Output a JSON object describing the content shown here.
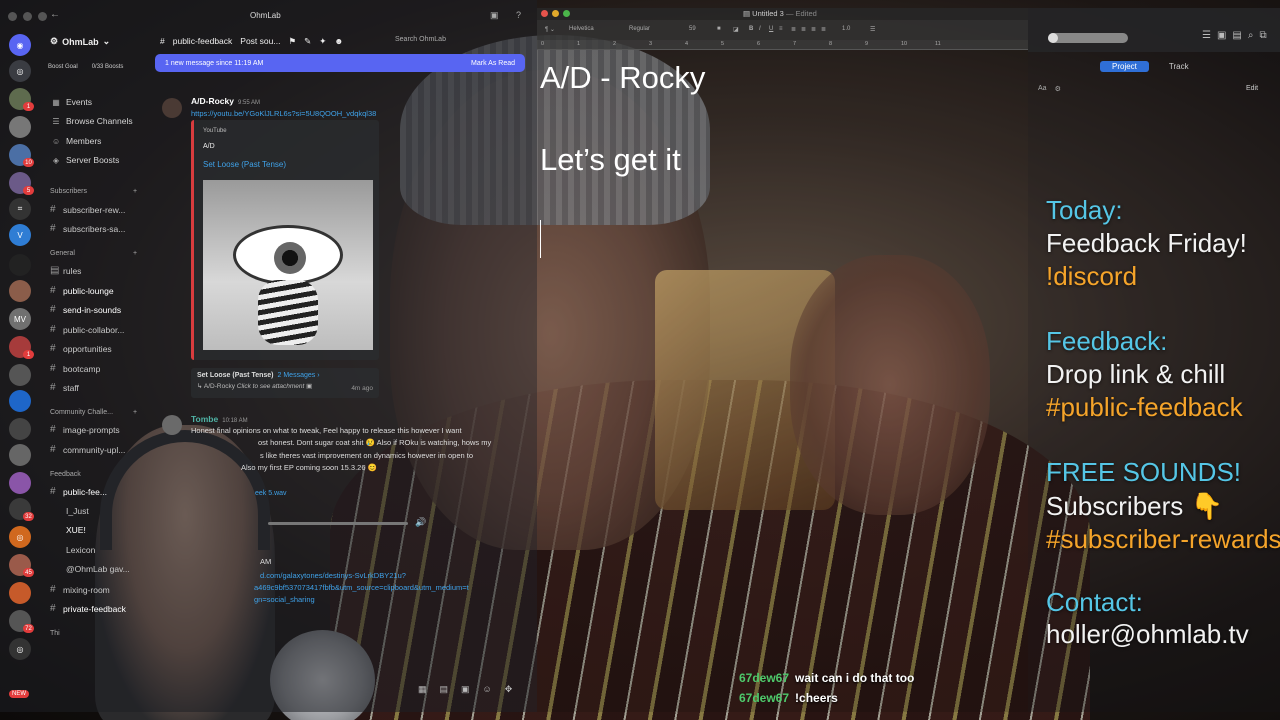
{
  "discord": {
    "window_title": "OhmLab",
    "server_name": "OhmLab",
    "boost_goal_label": "Boost Goal",
    "boost_count": "0/33 Boosts",
    "nav": [
      "Events",
      "Browse Channels",
      "Members",
      "Server Boosts"
    ],
    "categories": {
      "subscribers": "Subscribers",
      "general": "General",
      "community": "Community Challe...",
      "feedback": "Feedback",
      "truncated": "Thi"
    },
    "channels": {
      "subscriber_rewards": "subscriber-rew...",
      "subscribers_sa": "subscribers-sa...",
      "rules": "rules",
      "public_lounge": "public-lounge",
      "send_in_sounds": "send-in-sounds",
      "public_collabor": "public-collabor...",
      "opportunities": "opportunities",
      "bootcamp": "bootcamp",
      "staff": "staff",
      "image_prompts": "image-prompts",
      "community_upl": "community-upl...",
      "public_feedback": "public-fee...",
      "sub_i_just": "I_Just",
      "sub_xuei": "XUE!",
      "sub_lexicon": "Lexicon",
      "sub_ohmlab": "@OhmLab gav...",
      "mixing_room": "mixing-room",
      "private_feedback": "private-feedback"
    },
    "rail_badges": [
      "1",
      "10",
      "5",
      "1",
      "32",
      "45",
      "72"
    ],
    "rail_new": "NEW",
    "channel_header": "public-feedback",
    "header_post": "Post sou...",
    "search_placeholder": "Search OhmLab",
    "new_messages_banner": "1 new message since 11:19 AM",
    "mark_as_read": "Mark As Read",
    "msg1": {
      "author": "A/D-Rocky",
      "time": "9:55 AM",
      "link": "https://youtu.be/YGoKlJLRL6s?si=5U8QOOH_vdqkql38",
      "embed_provider": "YouTube",
      "embed_author": "A/D",
      "embed_title": "Set Loose (Past Tense)"
    },
    "thread": {
      "title": "Set Loose (Past Tense)",
      "count": "2 Messages ›",
      "author": "A/D-Rocky",
      "preview": "Click to see attachment",
      "ago": "4m ago"
    },
    "msg2": {
      "author": "Tombe",
      "time": "10:18 AM",
      "line1": "Honest final opinions on what to tweak, Feel happy to release this however I want",
      "line2": "ost honest. Dont sugar coat shit 😢 Also if ROku is watching, hows my",
      "line3": "s like theres vast improvement on dynamics however im open to",
      "line4": "Also my first EP coming soon 15.3.26 😊",
      "attachment": "eek 5.wav"
    },
    "msg3": {
      "time": "AM",
      "link1": "d.com/galaxytones/destinys-SvLrkDBY21u?",
      "link2": "a469c9bf537073417fbfb&utm_source=clipboard&utm_medium=t",
      "link3": "gn=social_sharing"
    }
  },
  "textedit": {
    "title": "Untitled 3",
    "edited": "— Edited",
    "font": "Helvetica",
    "style": "Regular",
    "size": "59",
    "spacing": "1.0",
    "ruler": [
      "0",
      "1",
      "2",
      "3",
      "4",
      "5",
      "6",
      "7",
      "8",
      "9",
      "10",
      "11"
    ],
    "line1": "A/D - Rocky",
    "line2": "Let’s get it"
  },
  "music": {
    "tab_project": "Project",
    "tab_track": "Track",
    "aa": "Aa",
    "edit": "Edit"
  },
  "overlay": {
    "today_heading": "Today:",
    "today_line1": "Feedback Friday!",
    "today_line2": "!discord",
    "feedback_heading": "Feedback:",
    "feedback_line1": "Drop link & chill",
    "feedback_line2": "#public-feedback",
    "free_heading": "FREE SOUNDS!",
    "free_line1": "Subscribers 👇",
    "free_line2": "#subscriber-rewards",
    "contact_heading": "Contact:",
    "contact_line1": "holler@ohmlab.tv"
  },
  "stream_chat": [
    {
      "user": "67dew67",
      "text": "wait can i do that too"
    },
    {
      "user": "67dew67",
      "text": "!cheers"
    }
  ],
  "colors": {
    "discord_blurple": "#5865f2",
    "link_blue": "#3fa2e9",
    "overlay_cyan": "#55c6e6",
    "overlay_orange": "#f5a42a",
    "chat_user_green": "#4ec96b",
    "embed_red": "#d83c3e"
  }
}
